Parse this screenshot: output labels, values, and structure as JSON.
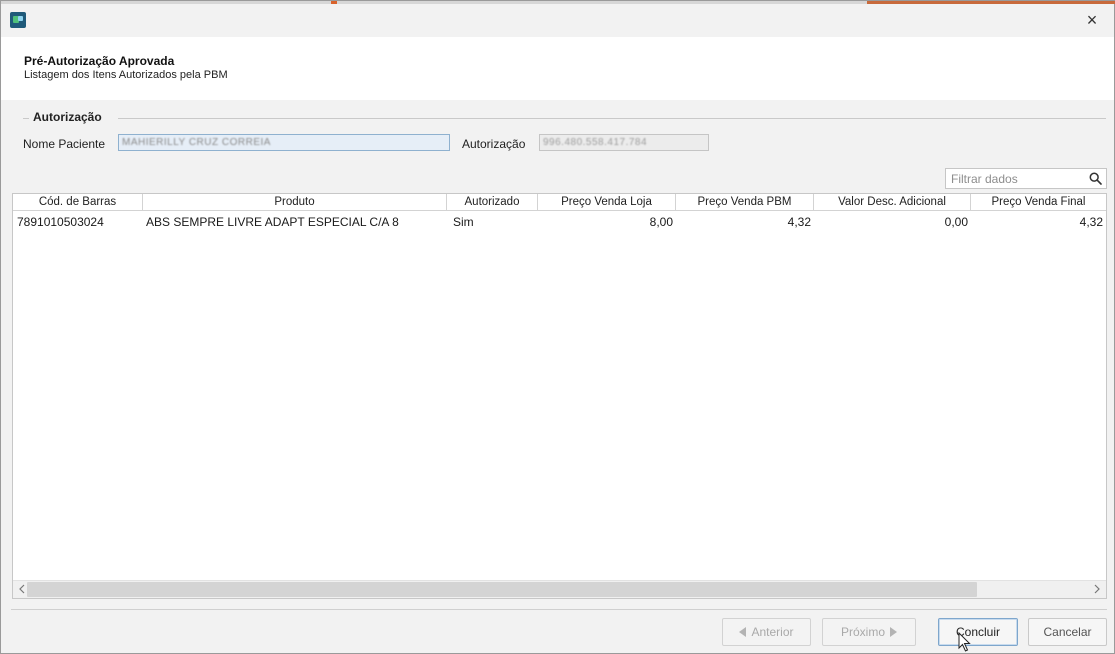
{
  "window": {
    "close_label": "×"
  },
  "header": {
    "title": "Pré-Autorização Aprovada",
    "subtitle": "Listagem dos Itens Autorizados pela PBM"
  },
  "group": {
    "label": "Autorização"
  },
  "form": {
    "paciente_label": "Nome Paciente",
    "paciente_value": "MAHIERILLY CRUZ CORREIA",
    "autorizacao_label": "Autorização",
    "autorizacao_value": "996.480.558.417.784"
  },
  "filter": {
    "placeholder": "Filtrar dados"
  },
  "table": {
    "columns": [
      "Cód. de Barras",
      "Produto",
      "Autorizado",
      "Preço Venda Loja",
      "Preço Venda PBM",
      "Valor Desc. Adicional",
      "Preço Venda Final"
    ],
    "rows": [
      {
        "codigo": "7891010503024",
        "produto": "ABS SEMPRE LIVRE ADAPT ESPECIAL C/A 8",
        "autorizado": "Sim",
        "preco_loja": "8,00",
        "preco_pbm": "4,32",
        "desconto": "0,00",
        "preco_final": "4,32"
      }
    ]
  },
  "buttons": {
    "anterior": "Anterior",
    "proximo": "Próximo",
    "concluir": "Concluir",
    "cancelar": "Cancelar"
  },
  "colors": {
    "accent": "#d9622b",
    "field_border": "#8fb1cf",
    "field_bg": "#e6eef7"
  }
}
